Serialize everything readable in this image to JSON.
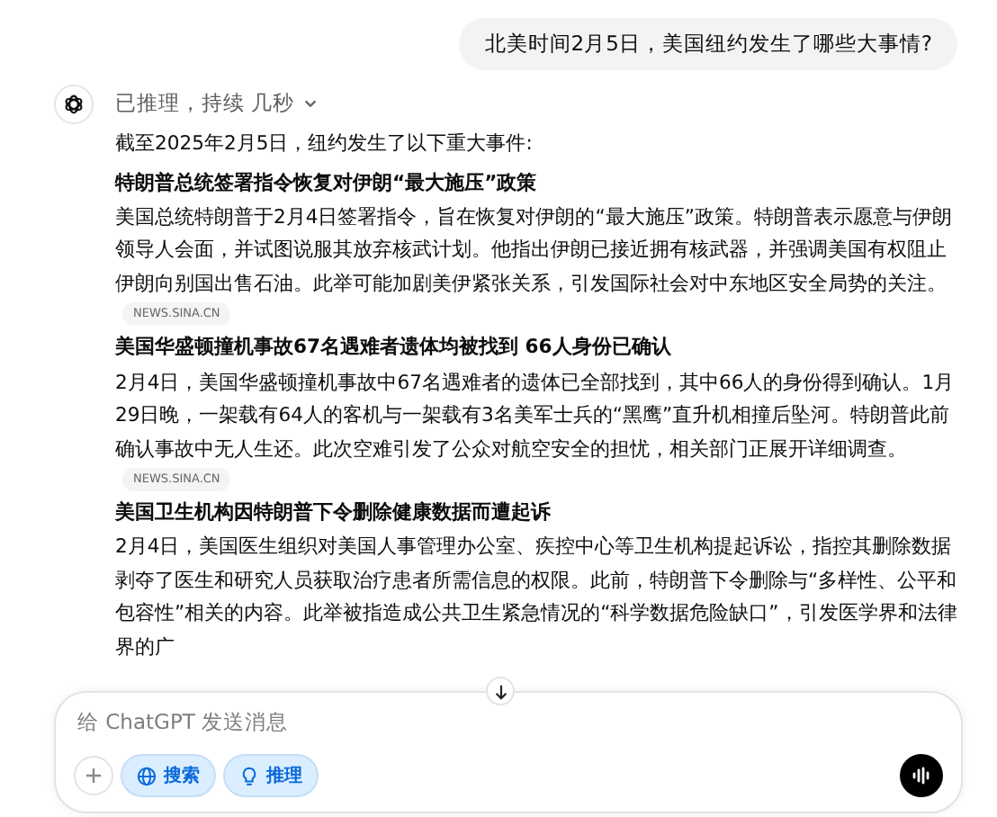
{
  "user_message": "北美时间2月5日，美国纽约发生了哪些大事情?",
  "reasoning": {
    "label": "已推理，持续 几秒",
    "expanded": false
  },
  "intro": "截至2025年2月5日，纽约发生了以下重大事件:",
  "sections": [
    {
      "heading": "特朗普总统签署指令恢复对伊朗“最大施压”政策",
      "body": "美国总统特朗普于2月4日签署指令，旨在恢复对伊朗的“最大施压”政策。特朗普表示愿意与伊朗领导人会面，并试图说服其放弃核武计划。他指出伊朗已接近拥有核武器，并强调美国有权阻止伊朗向别国出售石油。此举可能加剧美伊紧张关系，引发国际社会对中东地区安全局势的关注。",
      "source": "NEWS.SINA.CN"
    },
    {
      "heading": "美国华盛顿撞机事故67名遇难者遗体均被找到 66人身份已确认",
      "body": "2月4日，美国华盛顿撞机事故中67名遇难者的遗体已全部找到，其中66人的身份得到确认。1月29日晚，一架载有64人的客机与一架载有3名美军士兵的“黑鹰”直升机相撞后坠河。特朗普此前确认事故中无人生还。此次空难引发了公众对航空安全的担忧，相关部门正展开详细调查。",
      "source": "NEWS.SINA.CN"
    },
    {
      "heading": "美国卫生机构因特朗普下令删除健康数据而遭起诉",
      "body": "2月4日，美国医生组织对美国人事管理办公室、疾控中心等卫生机构提起诉讼，指控其删除数据剥夺了医生和研究人员获取治疗患者所需信息的权限。此前，特朗普下令删除与“多样性、公平和包容性”相关的内容。此举被指造成公共卫生紧急情况的“科学数据危险缺口”，引发医学界和法律界的广"
    }
  ],
  "composer": {
    "placeholder": "给 ChatGPT 发送消息",
    "tools": [
      {
        "kind": "search",
        "label": "搜索",
        "selected": true
      },
      {
        "kind": "reason",
        "label": "推理",
        "selected": true
      }
    ]
  }
}
